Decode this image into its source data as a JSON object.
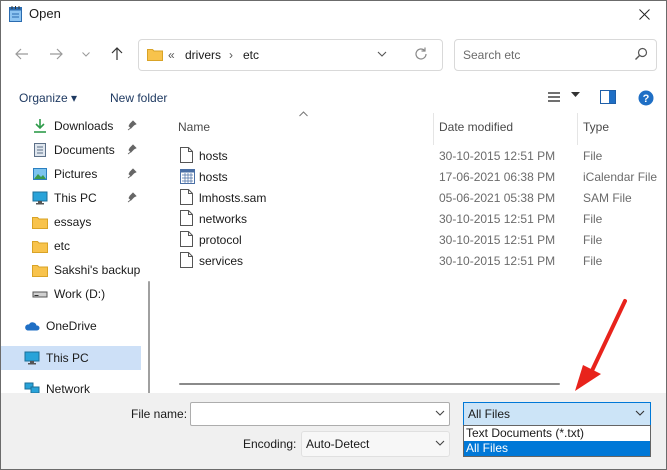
{
  "window": {
    "title": "Open"
  },
  "address": {
    "overflow": "«",
    "crumbs": [
      "drivers",
      "etc"
    ],
    "separator": "›"
  },
  "search": {
    "placeholder": "Search etc"
  },
  "toolbar": {
    "organize": "Organize",
    "organize_caret": "▾",
    "new_folder": "New folder"
  },
  "nav": {
    "items": [
      {
        "label": "Downloads",
        "icon": "download-icon",
        "pinned": true
      },
      {
        "label": "Documents",
        "icon": "documents-icon",
        "pinned": true
      },
      {
        "label": "Pictures",
        "icon": "pictures-icon",
        "pinned": true
      },
      {
        "label": "This PC",
        "icon": "computer-icon",
        "pinned": true
      },
      {
        "label": "essays",
        "icon": "folder-icon",
        "pinned": false
      },
      {
        "label": "etc",
        "icon": "folder-icon",
        "pinned": false
      },
      {
        "label": "Sakshi's backup",
        "icon": "folder-icon",
        "pinned": false
      },
      {
        "label": "Work (D:)",
        "icon": "drive-icon",
        "pinned": false
      }
    ],
    "onedrive": "OneDrive",
    "thispc": "This PC",
    "network": "Network"
  },
  "columns": {
    "name": "Name",
    "date": "Date modified",
    "type": "Type"
  },
  "files": [
    {
      "name": "hosts",
      "date": "30-10-2015 12:51 PM",
      "type": "File",
      "icon": "file-icon"
    },
    {
      "name": "hosts",
      "date": "17-06-2021 06:38 PM",
      "type": "iCalendar File",
      "icon": "calendar-file-icon"
    },
    {
      "name": "lmhosts.sam",
      "date": "05-06-2021 05:38 PM",
      "type": "SAM File",
      "icon": "file-icon"
    },
    {
      "name": "networks",
      "date": "30-10-2015 12:51 PM",
      "type": "File",
      "icon": "file-icon"
    },
    {
      "name": "protocol",
      "date": "30-10-2015 12:51 PM",
      "type": "File",
      "icon": "file-icon"
    },
    {
      "name": "services",
      "date": "30-10-2015 12:51 PM",
      "type": "File",
      "icon": "file-icon"
    }
  ],
  "bottom": {
    "filename_label": "File name:",
    "filename_value": "",
    "filetype_selected": "All Files",
    "filetype_options": [
      "Text Documents (*.txt)",
      "All Files"
    ],
    "encoding_label": "Encoding:",
    "encoding_value": "Auto-Detect"
  },
  "colors": {
    "accent": "#0078d7",
    "selection": "#cde0f7",
    "annotation_arrow": "#e8231c"
  }
}
